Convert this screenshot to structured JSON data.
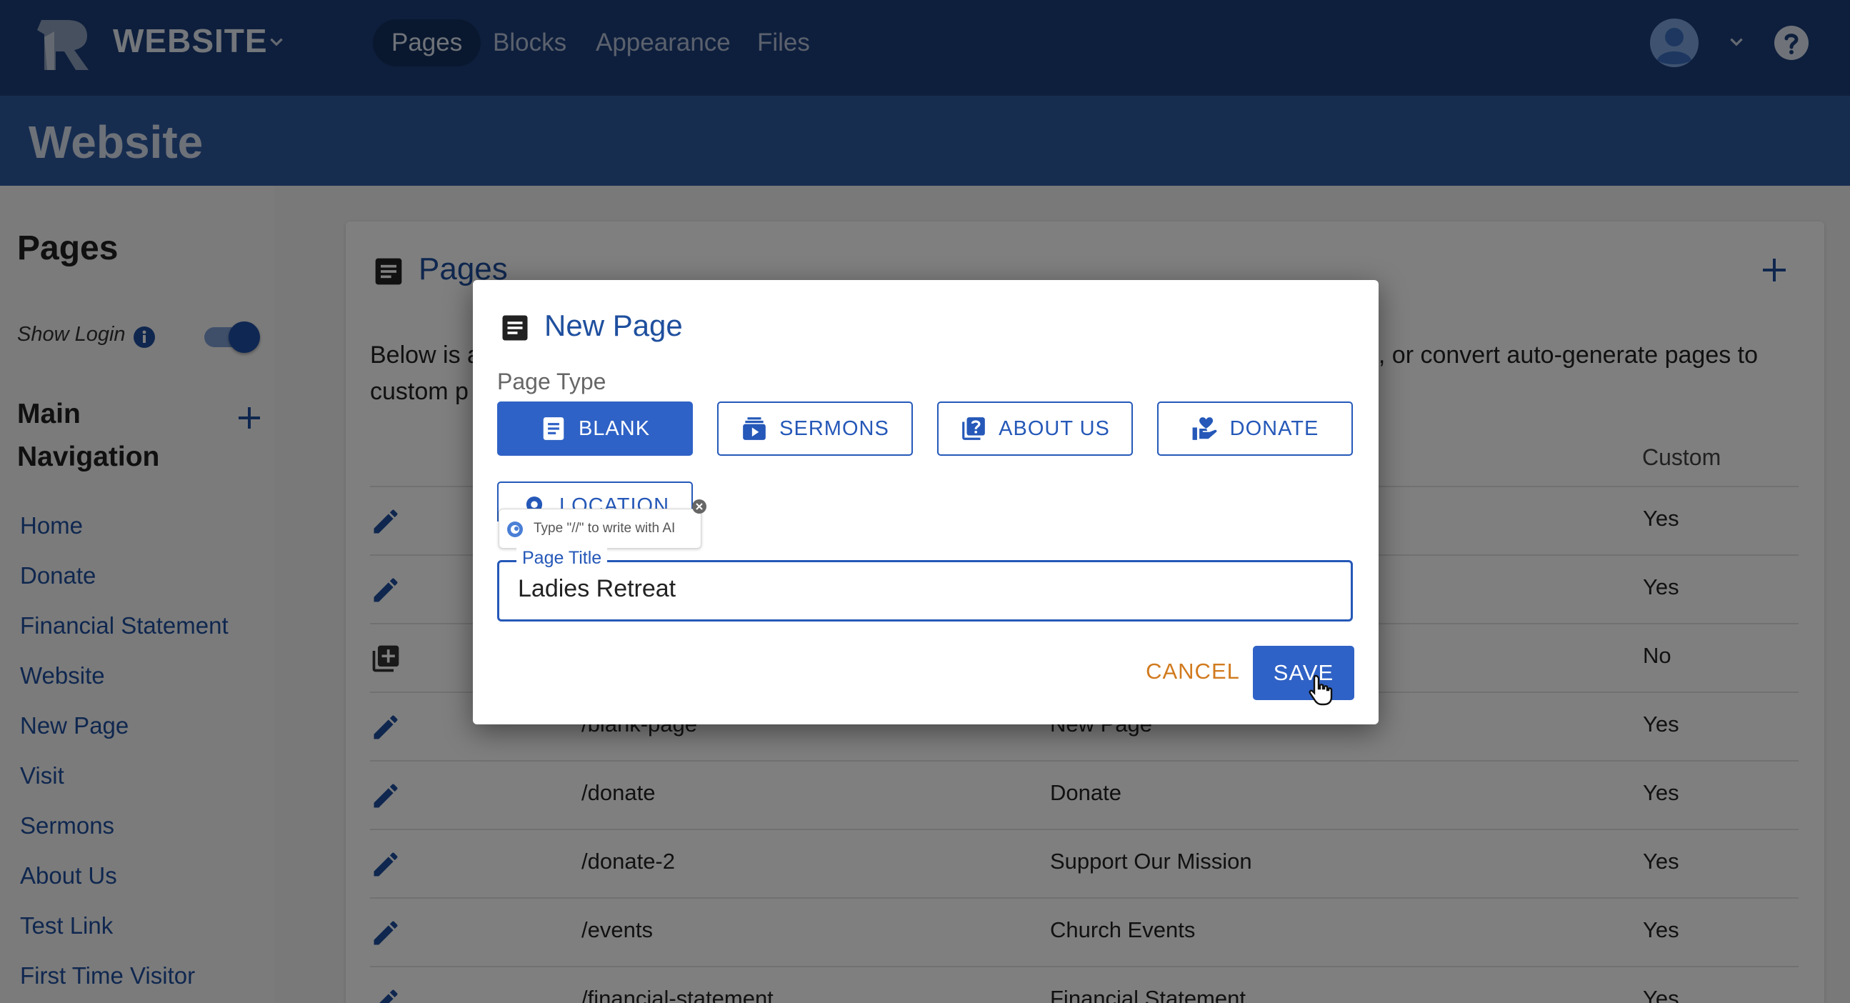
{
  "topbar": {
    "brand": "WEBSITE",
    "tabs": [
      {
        "label": "Pages",
        "active": true
      },
      {
        "label": "Blocks",
        "active": false
      },
      {
        "label": "Appearance",
        "active": false
      },
      {
        "label": "Files",
        "active": false
      }
    ]
  },
  "header": {
    "title": "Website"
  },
  "sidebar": {
    "title": "Pages",
    "show_login_label": "Show Login",
    "show_login_on": true,
    "nav_title": "Main Navigation",
    "items": [
      "Home",
      "Donate",
      "Financial Statement",
      "Website",
      "New Page",
      "Visit",
      "Sermons",
      "About Us",
      "Test Link",
      "First Time Visitor"
    ]
  },
  "card": {
    "title": "Pages",
    "desc_start": "Below is a",
    "desc_end": "es, or convert auto-generate pages to",
    "desc_line2": "custom p",
    "custom_header": "Custom",
    "rows": [
      {
        "url": "",
        "title": "",
        "custom": "Yes",
        "icon": "edit-icon"
      },
      {
        "url": "",
        "title": "",
        "custom": "Yes",
        "icon": "edit-icon"
      },
      {
        "url": "",
        "title": "",
        "custom": "No",
        "icon": "add-page-icon"
      },
      {
        "url": "/blank-page",
        "title": "New Page",
        "custom": "Yes",
        "icon": "edit-icon"
      },
      {
        "url": "/donate",
        "title": "Donate",
        "custom": "Yes",
        "icon": "edit-icon"
      },
      {
        "url": "/donate-2",
        "title": "Support Our Mission",
        "custom": "Yes",
        "icon": "edit-icon"
      },
      {
        "url": "/events",
        "title": "Church Events",
        "custom": "Yes",
        "icon": "edit-icon"
      },
      {
        "url": "/financial-statement",
        "title": "Financial Statement",
        "custom": "Yes",
        "icon": "edit-icon"
      }
    ]
  },
  "dialog": {
    "title": "New Page",
    "page_type_label": "Page Type",
    "types": [
      {
        "label": "BLANK",
        "icon": "document-icon",
        "active": true
      },
      {
        "label": "SERMONS",
        "icon": "sermons-icon",
        "active": false
      },
      {
        "label": "ABOUT US",
        "icon": "question-book-icon",
        "active": false
      },
      {
        "label": "DONATE",
        "icon": "donate-hand-icon",
        "active": false
      },
      {
        "label": "LOCATION",
        "icon": "location-pin-icon",
        "active": false
      }
    ],
    "ai_tip": "Type \"//\" to write with AI",
    "field_label": "Page Title",
    "field_value": "Ladies Retreat",
    "cancel_label": "CANCEL",
    "save_label": "SAVE"
  },
  "colors": {
    "topbar": "#1d3f7b",
    "header_band": "#2e5aa0",
    "primary": "#2f62c6",
    "link": "#1f4f9e",
    "cancel": "#d17a1e"
  }
}
